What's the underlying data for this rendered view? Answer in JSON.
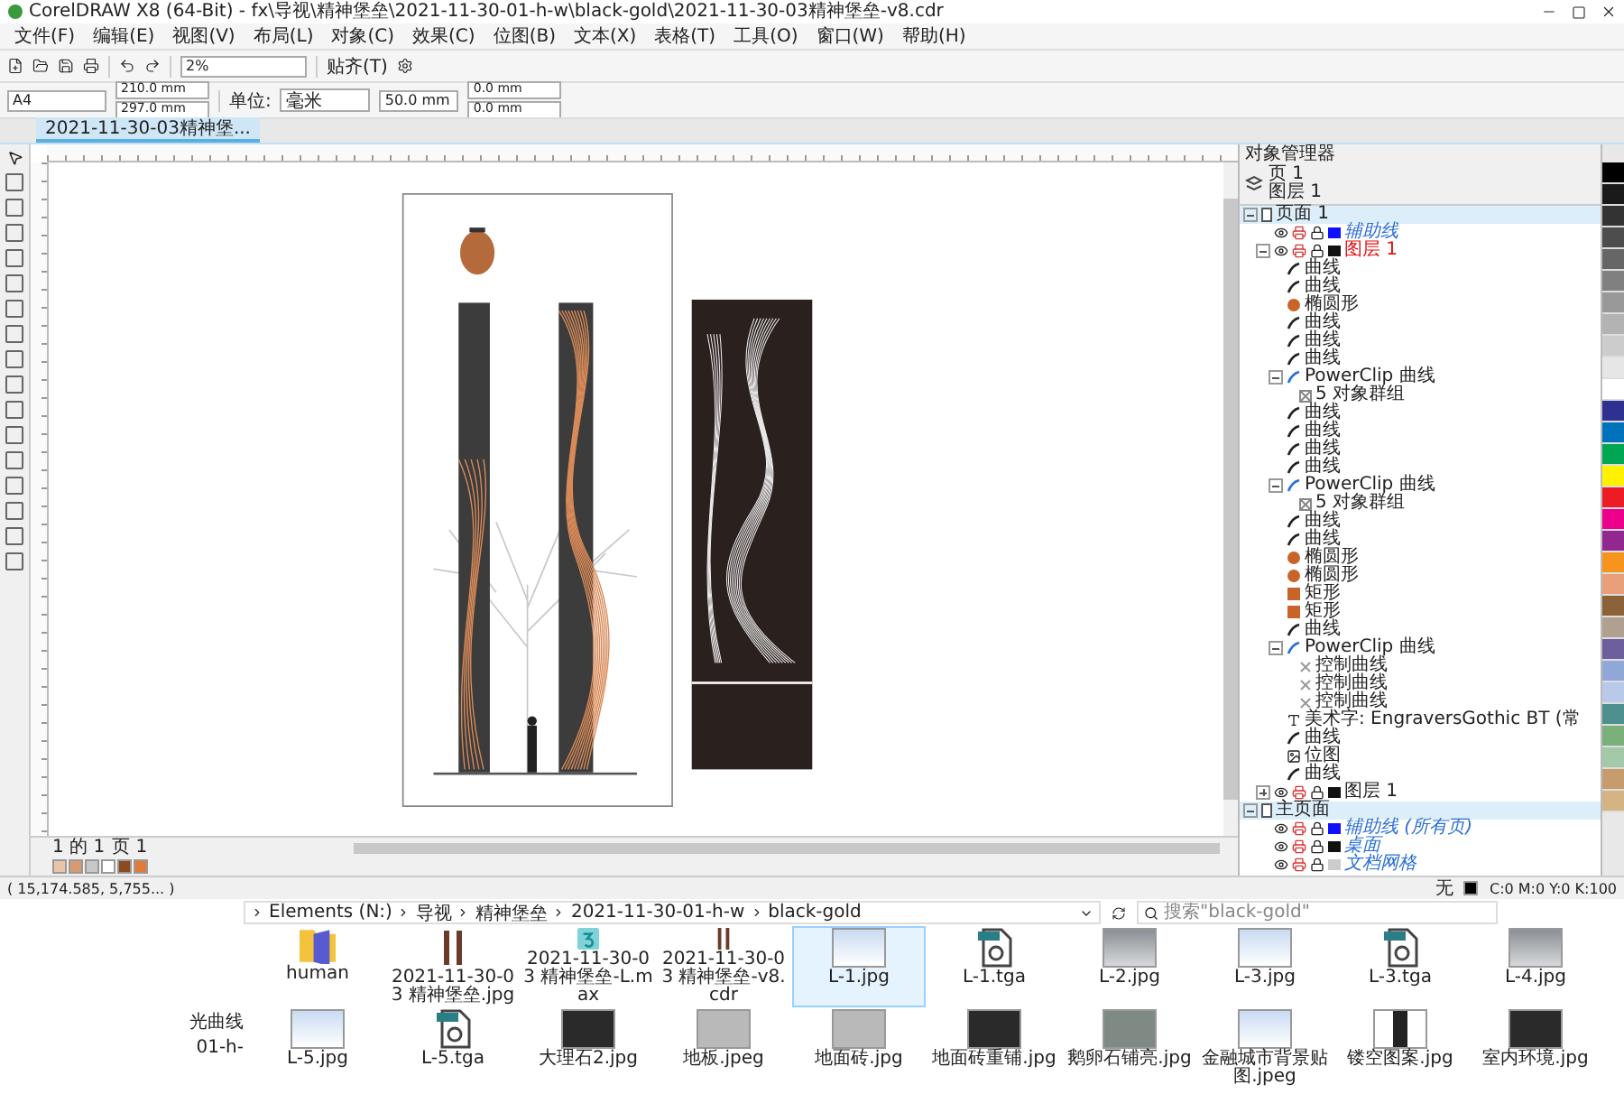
{
  "window": {
    "title": "CorelDRAW X8 (64-Bit) - fx\\导视\\精神堡垒\\2021-11-30-01-h-w\\black-gold\\2021-11-30-03精神堡垒-v8.cdr"
  },
  "menu": [
    "文件(F)",
    "编辑(E)",
    "视图(V)",
    "布局(L)",
    "对象(C)",
    "效果(C)",
    "位图(B)",
    "文本(X)",
    "表格(T)",
    "工具(O)",
    "窗口(W)",
    "帮助(H)"
  ],
  "toolbar": {
    "zoom": "2%",
    "snap": "贴齐(T)"
  },
  "property_bar": {
    "page_size": "A4",
    "width": "210.0 mm",
    "height": "297.0 mm",
    "units_label": "单位:",
    "units": "毫米",
    "nudge": "50.0 mm",
    "dup_x": "0.0 mm",
    "dup_y": "0.0 mm"
  },
  "document_tabs": [
    {
      "label": "2021-11-30-03精神堡...",
      "selected": true
    }
  ],
  "page_nav": {
    "position": "1 的 1",
    "page_tab": "页 1"
  },
  "object_manager": {
    "title": "对象管理器",
    "page_label": "页 1",
    "layer_label": "图层 1",
    "tree": [
      {
        "label": "页面 1",
        "kind": "page",
        "expanded": true,
        "children": [
          {
            "label": "辅助线",
            "kind": "guide-layer",
            "color": "#1010ff"
          },
          {
            "label": "图层 1",
            "kind": "layer",
            "active": true,
            "color": "#111111",
            "expanded": true,
            "children": [
              {
                "label": "曲线",
                "kind": "curve"
              },
              {
                "label": "曲线",
                "kind": "curve"
              },
              {
                "label": "椭圆形",
                "kind": "ellipse"
              },
              {
                "label": "曲线",
                "kind": "curve"
              },
              {
                "label": "曲线",
                "kind": "curve"
              },
              {
                "label": "曲线",
                "kind": "curve"
              },
              {
                "label": "PowerClip 曲线",
                "kind": "powerclip",
                "expanded": true,
                "children": [
                  {
                    "label": "5 对象群组",
                    "kind": "group"
                  }
                ]
              },
              {
                "label": "曲线",
                "kind": "curve"
              },
              {
                "label": "曲线",
                "kind": "curve"
              },
              {
                "label": "曲线",
                "kind": "curve"
              },
              {
                "label": "曲线",
                "kind": "curve"
              },
              {
                "label": "PowerClip 曲线",
                "kind": "powerclip",
                "expanded": true,
                "children": [
                  {
                    "label": "5 对象群组",
                    "kind": "group"
                  }
                ]
              },
              {
                "label": "曲线",
                "kind": "curve"
              },
              {
                "label": "曲线",
                "kind": "curve"
              },
              {
                "label": "椭圆形",
                "kind": "ellipse"
              },
              {
                "label": "椭圆形",
                "kind": "ellipse"
              },
              {
                "label": "矩形",
                "kind": "rectangle"
              },
              {
                "label": "矩形",
                "kind": "rectangle"
              },
              {
                "label": "曲线",
                "kind": "curve"
              },
              {
                "label": "PowerClip 曲线",
                "kind": "powerclip",
                "expanded": true,
                "children": [
                  {
                    "label": "控制曲线",
                    "kind": "control"
                  },
                  {
                    "label": "控制曲线",
                    "kind": "control"
                  },
                  {
                    "label": "控制曲线",
                    "kind": "control"
                  }
                ]
              },
              {
                "label": "美术字: EngraversGothic BT (常",
                "kind": "text"
              },
              {
                "label": "曲线",
                "kind": "curve"
              },
              {
                "label": "位图",
                "kind": "bitmap"
              },
              {
                "label": "曲线",
                "kind": "curve"
              }
            ]
          },
          {
            "label": "图层 1",
            "kind": "layer",
            "active": false,
            "color": "#111111",
            "expanded": false
          }
        ]
      },
      {
        "label": "主页面",
        "kind": "page",
        "expanded": true,
        "children": [
          {
            "label": "辅助线 (所有页)",
            "kind": "guide-layer",
            "color": "#1010ff"
          },
          {
            "label": "桌面",
            "kind": "guide-layer",
            "color": "#111111"
          },
          {
            "label": "文档网格",
            "kind": "guide-layer",
            "color": "#cccccc"
          }
        ]
      }
    ]
  },
  "palette": [
    {
      "color": "#000000"
    },
    {
      "color": "#1a1a1a"
    },
    {
      "color": "#333333"
    },
    {
      "color": "#4d4d4d"
    },
    {
      "color": "#666666"
    },
    {
      "color": "#808080"
    },
    {
      "color": "#999999"
    },
    {
      "color": "#b3b3b3"
    },
    {
      "color": "#cccccc"
    },
    {
      "color": "#e6e6e6"
    },
    {
      "color": "#ffffff"
    },
    {
      "color": "#2e3192"
    },
    {
      "color": "#0072bc"
    },
    {
      "color": "#00a651"
    },
    {
      "color": "#fff200"
    },
    {
      "color": "#ed1c24"
    },
    {
      "color": "#ec008c"
    },
    {
      "color": "#92278f"
    },
    {
      "color": "#f7941d"
    },
    {
      "color": "#e8a07a"
    },
    {
      "color": "#8c6239"
    },
    {
      "color": "#b0a090"
    },
    {
      "color": "#6d5e9e"
    },
    {
      "color": "#8fa8d8"
    },
    {
      "color": "#b9c9e9"
    },
    {
      "color": "#4e8f8f"
    },
    {
      "color": "#7bb07b"
    },
    {
      "color": "#a3c9a8"
    },
    {
      "color": "#c69c6d"
    },
    {
      "color": "#d4b483"
    }
  ],
  "document_palette": [
    {
      "color": "#e8c4a8"
    },
    {
      "color": "#d89a70"
    },
    {
      "color": "#c8c8c8"
    },
    {
      "color": "#ffffff"
    },
    {
      "color": "#8c4a20"
    },
    {
      "color": "#e07b39"
    }
  ],
  "status_bar": {
    "coords": "( 15,174.585, 5,755... )",
    "fill": "无",
    "outline_color": "C:0 M:0 Y:0 K:100"
  },
  "explorer": {
    "path": [
      "Elements (N:)",
      "导视",
      "精神堡垒",
      "2021-11-30-01-h-w",
      "black-gold"
    ],
    "search": {
      "placeholder": "搜索\"black-gold\""
    },
    "nav": [
      "光曲线",
      "01-h-"
    ],
    "files": [
      {
        "name": "human",
        "kind": "folder",
        "selected": false
      },
      {
        "name": "2021-11-30-03 精神堡垒.jpg",
        "kind": "pillars",
        "selected": false
      },
      {
        "name": "2021-11-30-03 精神堡垒-L.max",
        "kind": "max",
        "selected": false
      },
      {
        "name": "2021-11-30-03 精神堡垒-v8.cdr",
        "kind": "pillars",
        "selected": false
      },
      {
        "name": "L-1.jpg",
        "kind": "sky",
        "selected": true
      },
      {
        "name": "L-1.tga",
        "kind": "tga",
        "selected": false
      },
      {
        "name": "L-2.jpg",
        "kind": "grey",
        "selected": false
      },
      {
        "name": "L-3.jpg",
        "kind": "sky",
        "selected": false
      },
      {
        "name": "L-3.tga",
        "kind": "tga",
        "selected": false
      },
      {
        "name": "L-4.jpg",
        "kind": "grey",
        "selected": false
      },
      {
        "name": "L-5.jpg",
        "kind": "sky",
        "selected": false
      },
      {
        "name": "L-5.tga",
        "kind": "tga",
        "selected": false
      },
      {
        "name": "大理石2.jpg",
        "kind": "dark",
        "selected": false
      },
      {
        "name": "地板.jpeg",
        "kind": "stone",
        "selected": false
      },
      {
        "name": "地面砖.jpg",
        "kind": "stone",
        "selected": false
      },
      {
        "name": "地面砖重铺.jpg",
        "kind": "dark",
        "selected": false
      },
      {
        "name": "鹅卵石铺亮.jpg",
        "kind": "pebble",
        "selected": false
      },
      {
        "name": "金融城市背景贴图.jpeg",
        "kind": "sky",
        "selected": false
      },
      {
        "name": "镂空图案.jpg",
        "kind": "pattern",
        "selected": false
      },
      {
        "name": "室内环境.jpg",
        "kind": "dark",
        "selected": false
      }
    ]
  }
}
